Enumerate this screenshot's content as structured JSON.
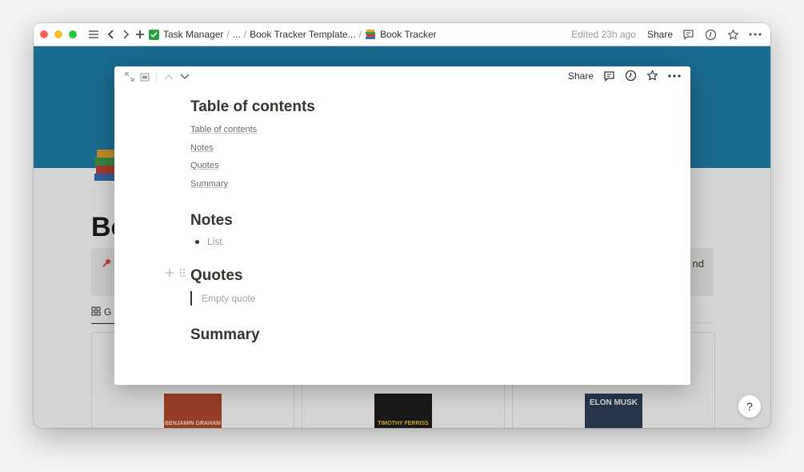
{
  "titlebar": {
    "crumbs": [
      {
        "label": "Task Manager",
        "icon": "check-box-icon"
      },
      {
        "label": "...",
        "icon": null
      },
      {
        "label": "Book Tracker Template...",
        "icon": null
      },
      {
        "label": "Book Tracker",
        "icon": "books-icon"
      }
    ],
    "edited": "Edited 23h ago",
    "share": "Share"
  },
  "colors": {
    "cover": "#1d7fac",
    "check": "#2aa14a"
  },
  "background_page": {
    "title_fragment": "Bo",
    "callout_fragment": "nd",
    "gallery_tab_fragment": "G",
    "books": [
      {
        "author": "BENJAMIN GRAHAM",
        "color": "#b5472b"
      },
      {
        "author": "TIMOTHY FERRISS",
        "color": "#1b1b1b"
      },
      {
        "author": "ELON MUSK",
        "color": "#2c3f56"
      }
    ],
    "help": "?"
  },
  "modal": {
    "share": "Share",
    "sections": {
      "toc_heading": "Table of contents",
      "toc_links": [
        "Table of contents",
        "Notes",
        "Quotes",
        "Summary"
      ],
      "notes_heading": "Notes",
      "notes_bullet": "List",
      "quotes_heading": "Quotes",
      "quote_placeholder": "Empty quote",
      "summary_heading": "Summary"
    }
  }
}
